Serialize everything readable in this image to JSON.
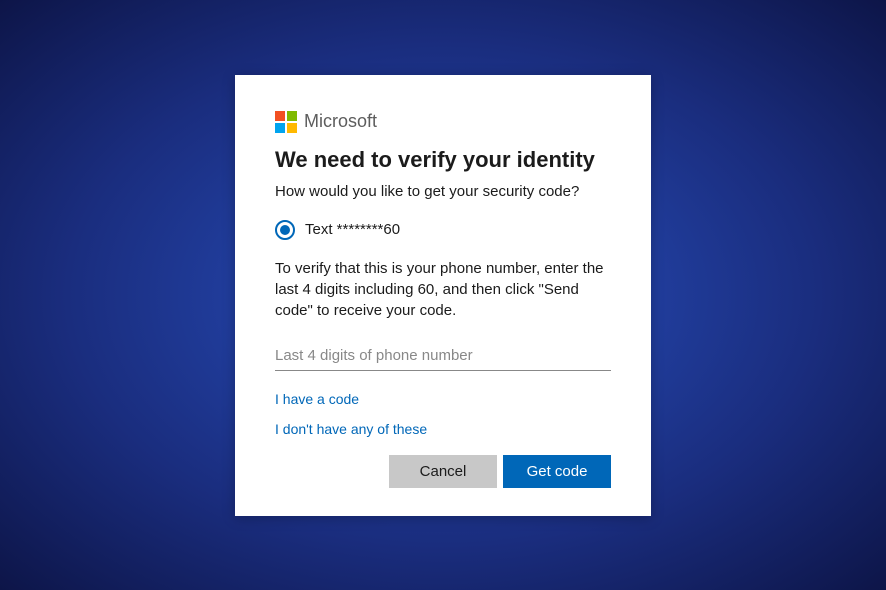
{
  "brand": {
    "name": "Microsoft",
    "logo_colors": {
      "tl": "#f25022",
      "tr": "#7fba00",
      "bl": "#00a4ef",
      "br": "#ffb900"
    }
  },
  "heading": "We need to verify your identity",
  "subheading": "How would you like to get your security code?",
  "options": [
    {
      "label": "Text ********60",
      "selected": true
    }
  ],
  "instructions": "To verify that this is your phone number, enter the last 4 digits including 60, and then click \"Send code\" to receive your code.",
  "input": {
    "placeholder": "Last 4 digits of phone number",
    "value": ""
  },
  "links": {
    "have_code": "I have a code",
    "no_options": "I don't have any of these"
  },
  "buttons": {
    "cancel": "Cancel",
    "submit": "Get code"
  },
  "colors": {
    "accent": "#0067b8"
  }
}
